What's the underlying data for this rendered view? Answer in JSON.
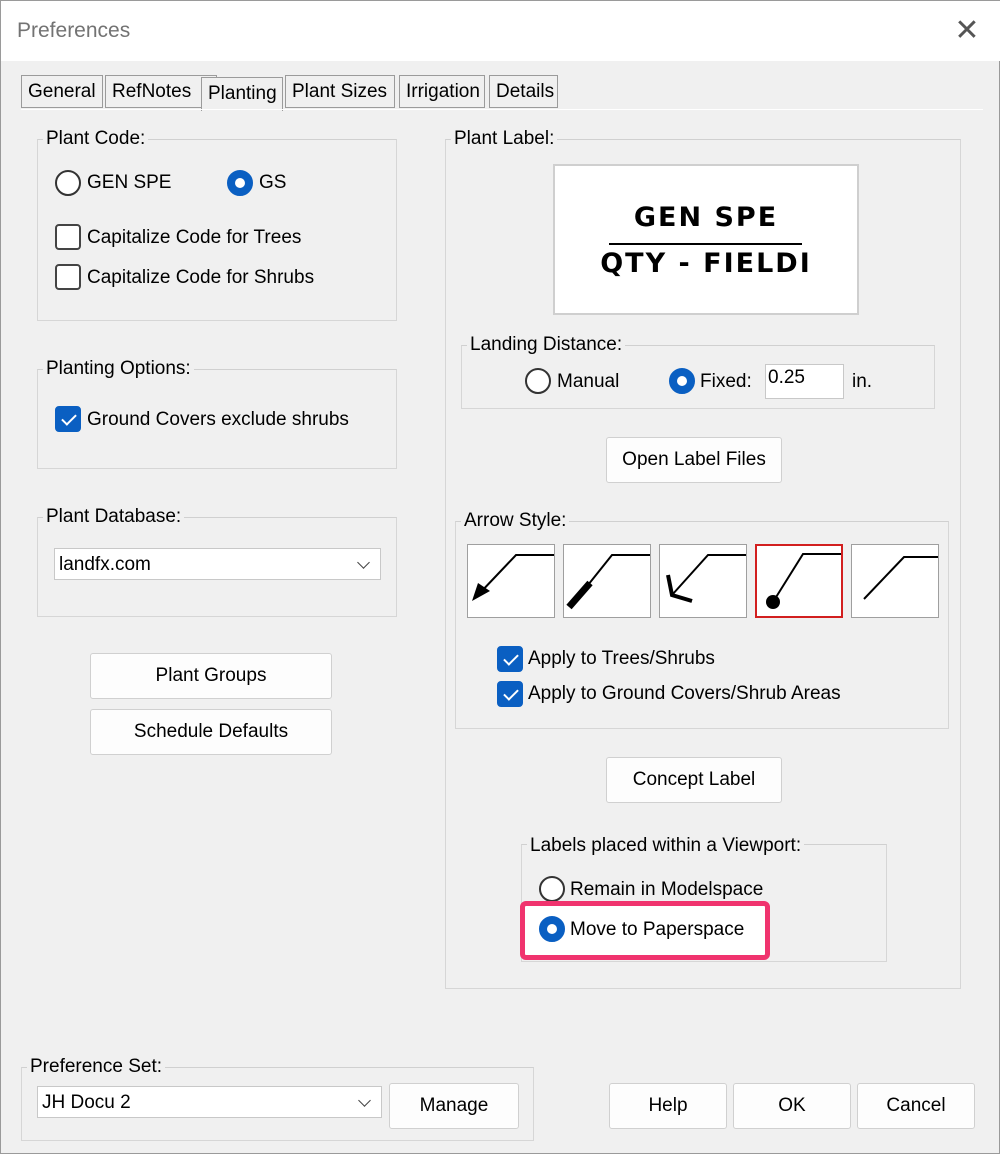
{
  "window": {
    "title": "Preferences",
    "close_icon": "close-icon"
  },
  "tabs": [
    {
      "label": "General",
      "active": false
    },
    {
      "label": "RefNotes",
      "active": false
    },
    {
      "label": "Planting",
      "active": true
    },
    {
      "label": "Plant Sizes",
      "active": false
    },
    {
      "label": "Irrigation",
      "active": false
    },
    {
      "label": "Details",
      "active": false
    }
  ],
  "plant_code": {
    "label": "Plant Code:",
    "options": [
      {
        "label": "GEN SPE",
        "selected": false
      },
      {
        "label": "GS",
        "selected": true
      }
    ],
    "capitalize_trees": {
      "label": "Capitalize Code for Trees",
      "checked": false
    },
    "capitalize_shrubs": {
      "label": "Capitalize Code for Shrubs",
      "checked": false
    }
  },
  "planting_options": {
    "label": "Planting Options:",
    "ground_covers": {
      "label": "Ground Covers exclude shrubs",
      "checked": true
    }
  },
  "plant_database": {
    "label": "Plant Database:",
    "value": "landfx.com"
  },
  "buttons": {
    "plant_groups": "Plant Groups",
    "schedule_defaults": "Schedule Defaults",
    "open_label_files": "Open Label Files",
    "concept_label": "Concept Label",
    "manage": "Manage",
    "help": "Help",
    "ok": "OK",
    "cancel": "Cancel"
  },
  "plant_label": {
    "label": "Plant Label:",
    "preview_line1": "GEN SPE",
    "preview_line2": "QTY - FIELDI"
  },
  "landing_distance": {
    "label": "Landing Distance:",
    "manual": {
      "label": "Manual",
      "selected": false
    },
    "fixed": {
      "label": "Fixed:",
      "selected": true
    },
    "value": "0.25",
    "unit": "in."
  },
  "arrow_style": {
    "label": "Arrow Style:",
    "styles": [
      "filled-arrow",
      "thick-line",
      "open-arrow",
      "dot",
      "plain-line"
    ],
    "selected_index": 3,
    "apply_trees": {
      "label": "Apply to Trees/Shrubs",
      "checked": true
    },
    "apply_ground": {
      "label": "Apply to Ground Covers/Shrub Areas",
      "checked": true
    }
  },
  "viewport": {
    "label": "Labels placed within a Viewport:",
    "remain": {
      "label": "Remain in Modelspace",
      "selected": false
    },
    "move": {
      "label": "Move to Paperspace",
      "selected": true
    }
  },
  "preference_set": {
    "label": "Preference Set:",
    "value": "JH Docu 2"
  },
  "colors": {
    "accent": "#0a5fc2",
    "highlight": "#f0336e",
    "selected_tile": "#d21f1f"
  }
}
